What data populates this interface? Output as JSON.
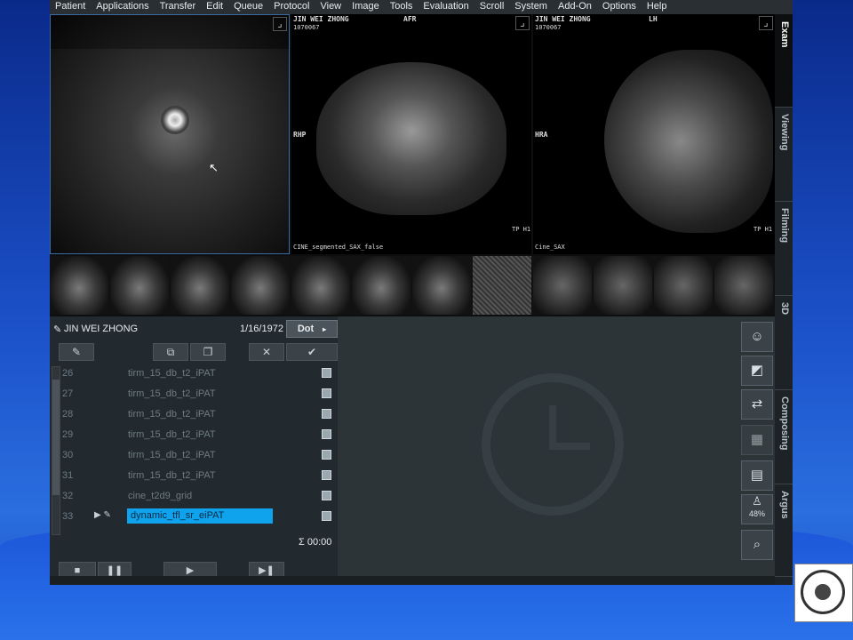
{
  "menu": [
    "Patient",
    "Applications",
    "Transfer",
    "Edit",
    "Queue",
    "Protocol",
    "View",
    "Image",
    "Tools",
    "Evaluation",
    "Scroll",
    "System",
    "Add-On",
    "Options",
    "Help"
  ],
  "viewports": {
    "v2": {
      "name": "JIN WEI ZHONG",
      "id": "1070067",
      "orient": "AFR",
      "left": "RHP",
      "bottom_right": "TP H1",
      "seq": "CINE_segmented_SAX_false"
    },
    "v3": {
      "name": "JIN WEI ZHONG",
      "id": "1070067",
      "orient": "LH",
      "left": "HRA",
      "bottom_right": "TP H1",
      "seq": "Cine_SAX"
    }
  },
  "tabs": [
    "Exam",
    "Viewing",
    "Filming",
    "3D",
    "Composing",
    "Argus"
  ],
  "queue": {
    "patient": "JIN WEI ZHONG",
    "dob": "1/16/1972",
    "mode": "Dot",
    "rows": [
      {
        "num": "26",
        "name": "tirm_15_db_t2_iPAT"
      },
      {
        "num": "27",
        "name": "tirm_15_db_t2_iPAT"
      },
      {
        "num": "28",
        "name": "tirm_15_db_t2_iPAT"
      },
      {
        "num": "29",
        "name": "tirm_15_db_t2_iPAT"
      },
      {
        "num": "30",
        "name": "tirm_15_db_t2_iPAT"
      },
      {
        "num": "31",
        "name": "tirm_15_db_t2_iPAT"
      },
      {
        "num": "32",
        "name": "cine_t2d9_grid"
      },
      {
        "num": "33",
        "name": "dynamic_tfl_sr_eiPAT"
      }
    ],
    "total": "Σ 00:00"
  },
  "right_panel": {
    "percent": "48%"
  },
  "colors": {
    "selection": "#0fa3ee",
    "menu_bg": "#2a2f33"
  }
}
